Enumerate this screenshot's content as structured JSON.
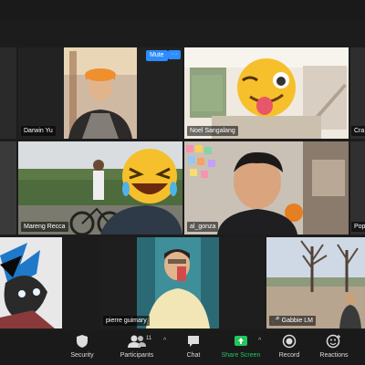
{
  "participants": [
    {
      "name": "Darwin Yu"
    },
    {
      "name": "Noel Sangalang"
    },
    {
      "name": "Cra"
    },
    {
      "name": "Mareng Recca"
    },
    {
      "name": "al_gonza"
    },
    {
      "name": "Pop"
    },
    {
      "name": "pierre guimary"
    },
    {
      "name": "Gabbie LM"
    }
  ],
  "hover_controls": {
    "mute_label": "Mute",
    "more_label": "···"
  },
  "toolbar": {
    "security": "Security",
    "participants": "Participants",
    "participants_count": "11",
    "chat": "Chat",
    "share_screen": "Share Screen",
    "record": "Record",
    "reactions": "Reactions"
  },
  "colors": {
    "accent": "#2d8cff",
    "active_speaker": "#b5d33c",
    "share_green": "#22c55e"
  }
}
